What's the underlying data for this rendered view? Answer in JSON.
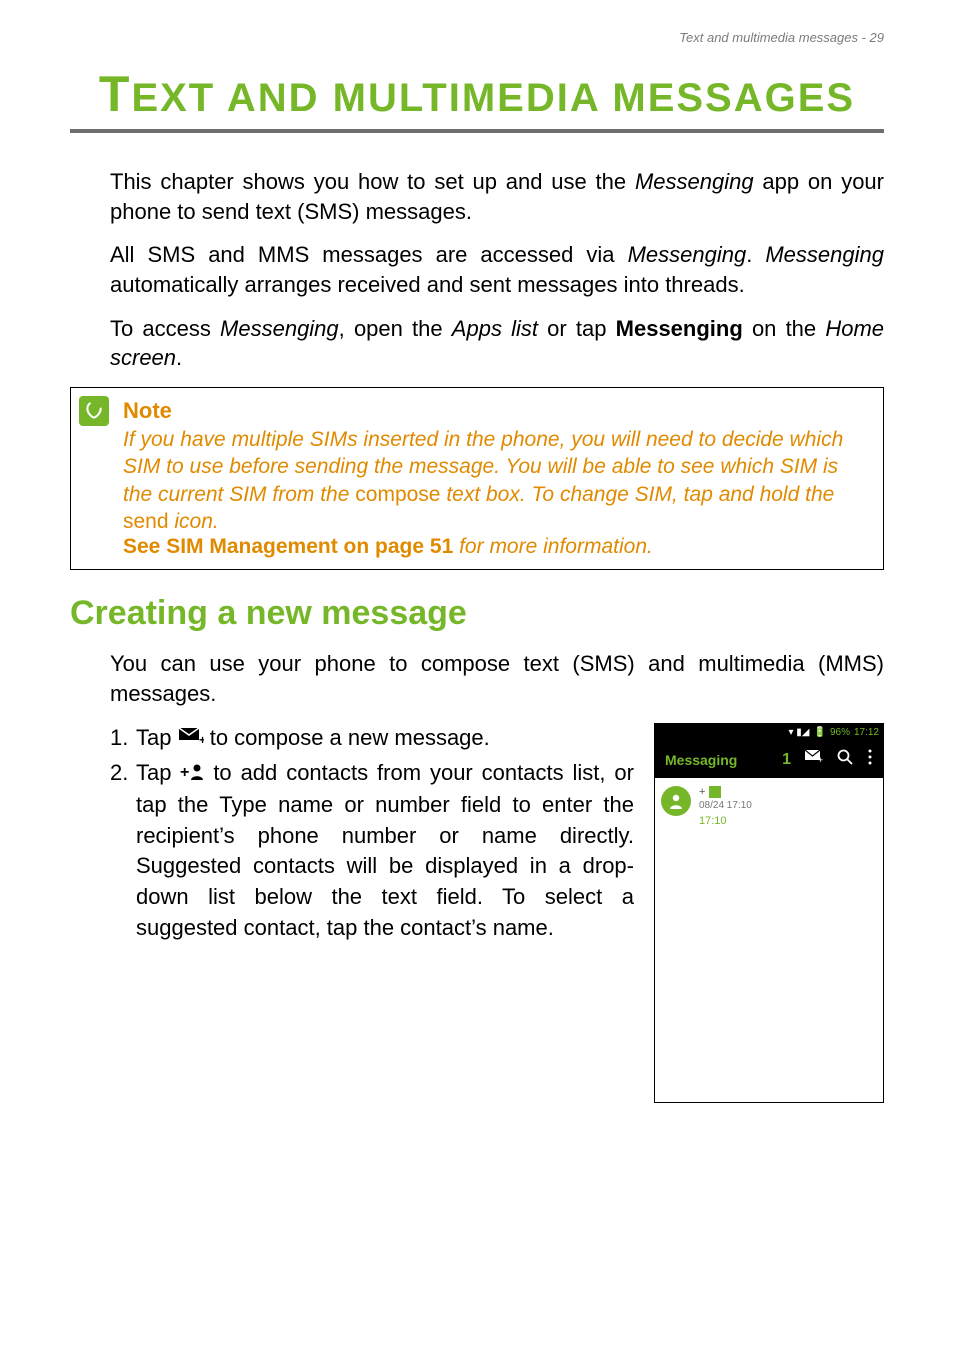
{
  "running_header": "Text and multimedia messages - 29",
  "chapter_title": {
    "first_char": "T",
    "rest": "EXT AND MULTIMEDIA MESSAGES"
  },
  "para1": {
    "pre": "This chapter shows you how to set up and use the ",
    "app": "Messenging",
    "post": " app on your phone to send text (SMS) messages."
  },
  "para2": {
    "a": "All SMS and MMS messages are accessed via ",
    "b": "Messenging",
    "c": ". ",
    "d": "Messenging",
    "e": " automatically arranges received and sent messages into threads."
  },
  "para3": {
    "a": "To access ",
    "b": "Messenging",
    "c": ", open the ",
    "d": "Apps list",
    "e": " or tap ",
    "f": "Messenging",
    "g": " on the ",
    "h": "Home screen",
    "i": "."
  },
  "note": {
    "label": "Note",
    "body_a": "If you have multiple SIMs inserted in the phone, you will need to decide which SIM to use before sending the message. You will be able to see which SIM is the current SIM from the ",
    "compose": "compose",
    "body_b": " text box. To change SIM, tap and hold the ",
    "send": "send",
    "body_c": " icon.",
    "link": "See SIM Management on page 51",
    "link_tail": " for more information."
  },
  "section_heading": "Creating a new message",
  "para4": "You can use your phone to compose text (SMS) and multimedia (MMS) messages.",
  "steps": {
    "s1": {
      "num": "1.",
      "a": "Tap ",
      "b": " to compose a new message."
    },
    "s2": {
      "num": "2.",
      "a": "Tap ",
      "b": " to add contacts from your contacts list, or tap the ",
      "c": "Type name or number",
      "d": " field to enter the recipient’s phone number or name directly. Suggested contacts will be displayed in a drop-down list below the text field. To select a suggested contact, tap the contact’s name."
    }
  },
  "screenshot": {
    "status": {
      "icons": "▾ ▮◢",
      "batt": "96%",
      "time": "17:12"
    },
    "topbar": {
      "title": "Messaging",
      "sim_badge": "1"
    },
    "row": {
      "plus": "+",
      "date": "08/24 17:10",
      "msg": "17:10"
    }
  }
}
